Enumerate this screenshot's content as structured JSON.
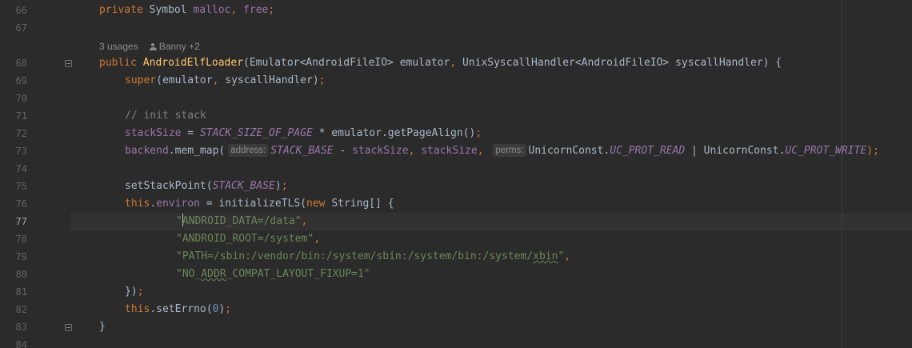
{
  "editor": {
    "line_numbers": [
      "66",
      "67",
      "68",
      "69",
      "70",
      "71",
      "72",
      "73",
      "74",
      "75",
      "76",
      "77",
      "78",
      "79",
      "80",
      "81",
      "82",
      "83",
      "84"
    ],
    "codelens": {
      "usages": "3 usages",
      "authors": "Banny +2"
    },
    "code": {
      "l66": {
        "t1": "private",
        "t2": " Symbol ",
        "t3": "malloc",
        "t4": ", ",
        "t5": "free",
        "t6": ";"
      },
      "l68": {
        "t1": "public ",
        "t2": "AndroidElfLoader",
        "t3": "(Emulator<AndroidFileIO> emulator",
        "t4": ", ",
        "t5": "UnixSyscallHandler<AndroidFileIO> syscallHandler) {"
      },
      "l69": {
        "t1": "super",
        "t2": "(emulator",
        "t3": ", ",
        "t4": "syscallHandler)",
        "t5": ";"
      },
      "l71": {
        "t1": "// init stack"
      },
      "l72": {
        "t1": "stackSize",
        "t2": " = ",
        "t3": "STACK_SIZE_OF_PAGE",
        "t4": " * emulator.getPageAlign()",
        "t5": ";"
      },
      "l73": {
        "t1": "backend",
        "t2": ".mem_map(",
        "hint1": "address:",
        "t3": "STACK_BASE",
        "t4": " - ",
        "t5": "stackSize",
        "t6": ", ",
        "t7": "stackSize",
        "t8": ", ",
        "hint2": "perms:",
        "t9": "UnicornConst.",
        "t10": "UC_PROT_READ",
        "t11": " | UnicornConst.",
        "t12": "UC_PROT_WRITE",
        "t13": ");"
      },
      "l75": {
        "t1": "setStackPoint(",
        "t2": "STACK_BASE",
        "t3": ")",
        "t4": ";"
      },
      "l76": {
        "t1": "this",
        "t2": ".",
        "t3": "environ",
        "t4": " = initializeTLS(",
        "t5": "new ",
        "t6": "String[] {"
      },
      "l77": {
        "q": "\"",
        "t1": "ANDROID_DATA=/data\"",
        "t2": ","
      },
      "l78": {
        "t1": "\"ANDROID_ROOT=/system\"",
        "t2": ","
      },
      "l79": {
        "t1": "\"PATH=/sbin:/vendor/bin:/system/sbin:/system/bin:/system/",
        "t2": "xbin",
        "t3": "\"",
        "t4": ","
      },
      "l80": {
        "t1": "\"NO_",
        "t2": "ADDR",
        "t3": "_COMPAT_LAYOUT_FIXUP=1\""
      },
      "l81": {
        "t1": "})",
        "t2": ";"
      },
      "l82": {
        "t1": "this",
        "t2": ".setErrno(",
        "t3": "0",
        "t4": ")",
        "t5": ";"
      },
      "l83": {
        "t1": "}"
      }
    }
  },
  "colors": {
    "background": "#2b2b2b",
    "keyword": "#cc7832",
    "field": "#9876aa",
    "function": "#ffc66d",
    "string": "#6a8759",
    "number": "#6897bb",
    "comment": "#808080",
    "text": "#a9b7c6",
    "line_number": "#606366"
  }
}
